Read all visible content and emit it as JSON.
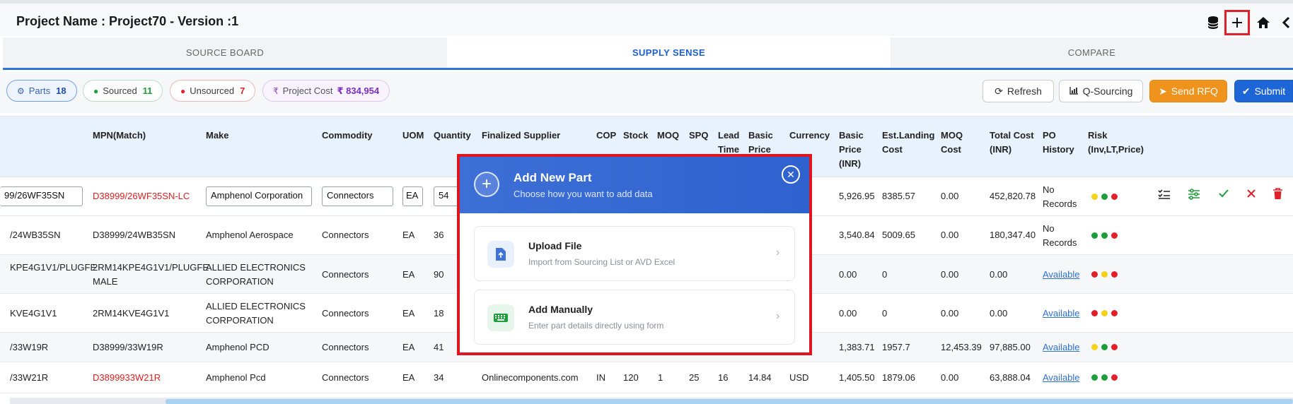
{
  "header": {
    "title": "Project Name : Project70 - Version :1",
    "icons": [
      "database-icon",
      "plus-icon",
      "home-icon",
      "back-icon"
    ]
  },
  "tabs": [
    {
      "label": "SOURCE BOARD",
      "active": false
    },
    {
      "label": "SUPPLY SENSE",
      "active": true
    },
    {
      "label": "COMPARE",
      "active": false
    }
  ],
  "stats": {
    "parts": {
      "label": "Parts",
      "count": "18"
    },
    "sourced": {
      "label": "Sourced",
      "count": "11"
    },
    "unsourced": {
      "label": "Unsourced",
      "count": "7"
    },
    "cost": {
      "label": "Project Cost",
      "value": "₹ 834,954"
    }
  },
  "toolbar": {
    "refresh": "Refresh",
    "qsourcing": "Q-Sourcing",
    "send_rfq": "Send RFQ",
    "submit": "Submit"
  },
  "table": {
    "headers": {
      "mpn": "MPN(Match)",
      "make": "Make",
      "commodity": "Commodity",
      "uom": "UOM",
      "quantity": "Quantity",
      "supplier": "Finalized Supplier",
      "cop": "COP",
      "stock": "Stock",
      "moq": "MOQ",
      "spq": "SPQ",
      "lead1": "Lead",
      "lead2": "Time",
      "basic1": "Basic",
      "basic2": "Price",
      "currency": "Currency",
      "bpinr1": "Basic",
      "bpinr2": "Price",
      "bpinr3": "(INR)",
      "est1": "Est.Landing",
      "est2": "Cost",
      "moqc1": "MOQ",
      "moqc2": "Cost",
      "total1": "Total Cost",
      "total2": "(INR)",
      "po1": "PO",
      "po2": "History",
      "risk1": "Risk",
      "risk2": "(Inv,LT,Price)"
    },
    "rows": [
      {
        "part": "99/26WF35SN",
        "mpn": "D38999/26WF35SN-LC",
        "make": "Amphenol Corporation",
        "commodity": "Connectors",
        "uom": "EA",
        "qty": "54",
        "bp_inr": "5,926.95",
        "est": "8385.57",
        "moq_cost": "0.00",
        "total": "452,820.78",
        "po1": "No",
        "po2": "Records"
      },
      {
        "part": "/24WB35SN",
        "mpn": "D38999/24WB35SN",
        "make": "Amphenol Aerospace",
        "commodity": "Connectors",
        "uom": "EA",
        "qty": "36",
        "bp_inr": "3,540.84",
        "est": "5009.65",
        "moq_cost": "0.00",
        "total": "180,347.40",
        "po1": "No",
        "po2": "Records"
      },
      {
        "part": "KPE4G1V1/PLUGFE",
        "mpn1": "2RM14KPE4G1V1/PLUGFE",
        "mpn2": "MALE",
        "make1": "ALLIED ELECTRONICS",
        "make2": "CORPORATION",
        "commodity": "Connectors",
        "uom": "EA",
        "qty": "90",
        "bp_inr": "0.00",
        "est": "0",
        "moq_cost": "0.00",
        "total": "0.00",
        "po": "Available"
      },
      {
        "part": "KVE4G1V1",
        "mpn": "2RM14KVE4G1V1",
        "make1": "ALLIED ELECTRONICS",
        "make2": "CORPORATION",
        "commodity": "Connectors",
        "uom": "EA",
        "qty": "18",
        "bp_inr": "0.00",
        "est": "0",
        "moq_cost": "0.00",
        "total": "0.00",
        "po": "Available"
      },
      {
        "part": "/33W19R",
        "mpn": "D38999/33W19R",
        "make": "Amphenol PCD",
        "commodity": "Connectors",
        "uom": "EA",
        "qty": "41",
        "bp_inr": "1,383.71",
        "est": "1957.7",
        "moq_cost": "12,453.39",
        "total": "97,885.00",
        "po": "Available"
      },
      {
        "part": "/33W21R",
        "mpn": "D3899933W21R",
        "make": "Amphenol Pcd",
        "commodity": "Connectors",
        "uom": "EA",
        "qty": "34",
        "supplier": "Onlinecomponents.com",
        "cop": "IN",
        "stock": "120",
        "moq": "1",
        "spq": "25",
        "lead": "16",
        "basic": "14.84",
        "currency": "USD",
        "bp_inr": "1,405.50",
        "est": "1879.06",
        "moq_cost": "0.00",
        "total": "63,888.04",
        "po": "Available"
      }
    ],
    "risk_colors": {
      "green": "#1e9e3a",
      "yellow": "#f2d21b",
      "red": "#e2202a"
    }
  },
  "modal": {
    "title": "Add New Part",
    "subtitle": "Choose how you want to add data",
    "options": [
      {
        "title": "Upload File",
        "desc": "Import from Sourcing List or AVD Excel",
        "icon": "file-upload-icon"
      },
      {
        "title": "Add Manually",
        "desc": "Enter part details directly using form",
        "icon": "keyboard-icon"
      }
    ]
  },
  "colors": {
    "accent": "#1e66d8",
    "highlight": "#e0151f",
    "orange": "#f0931c"
  }
}
